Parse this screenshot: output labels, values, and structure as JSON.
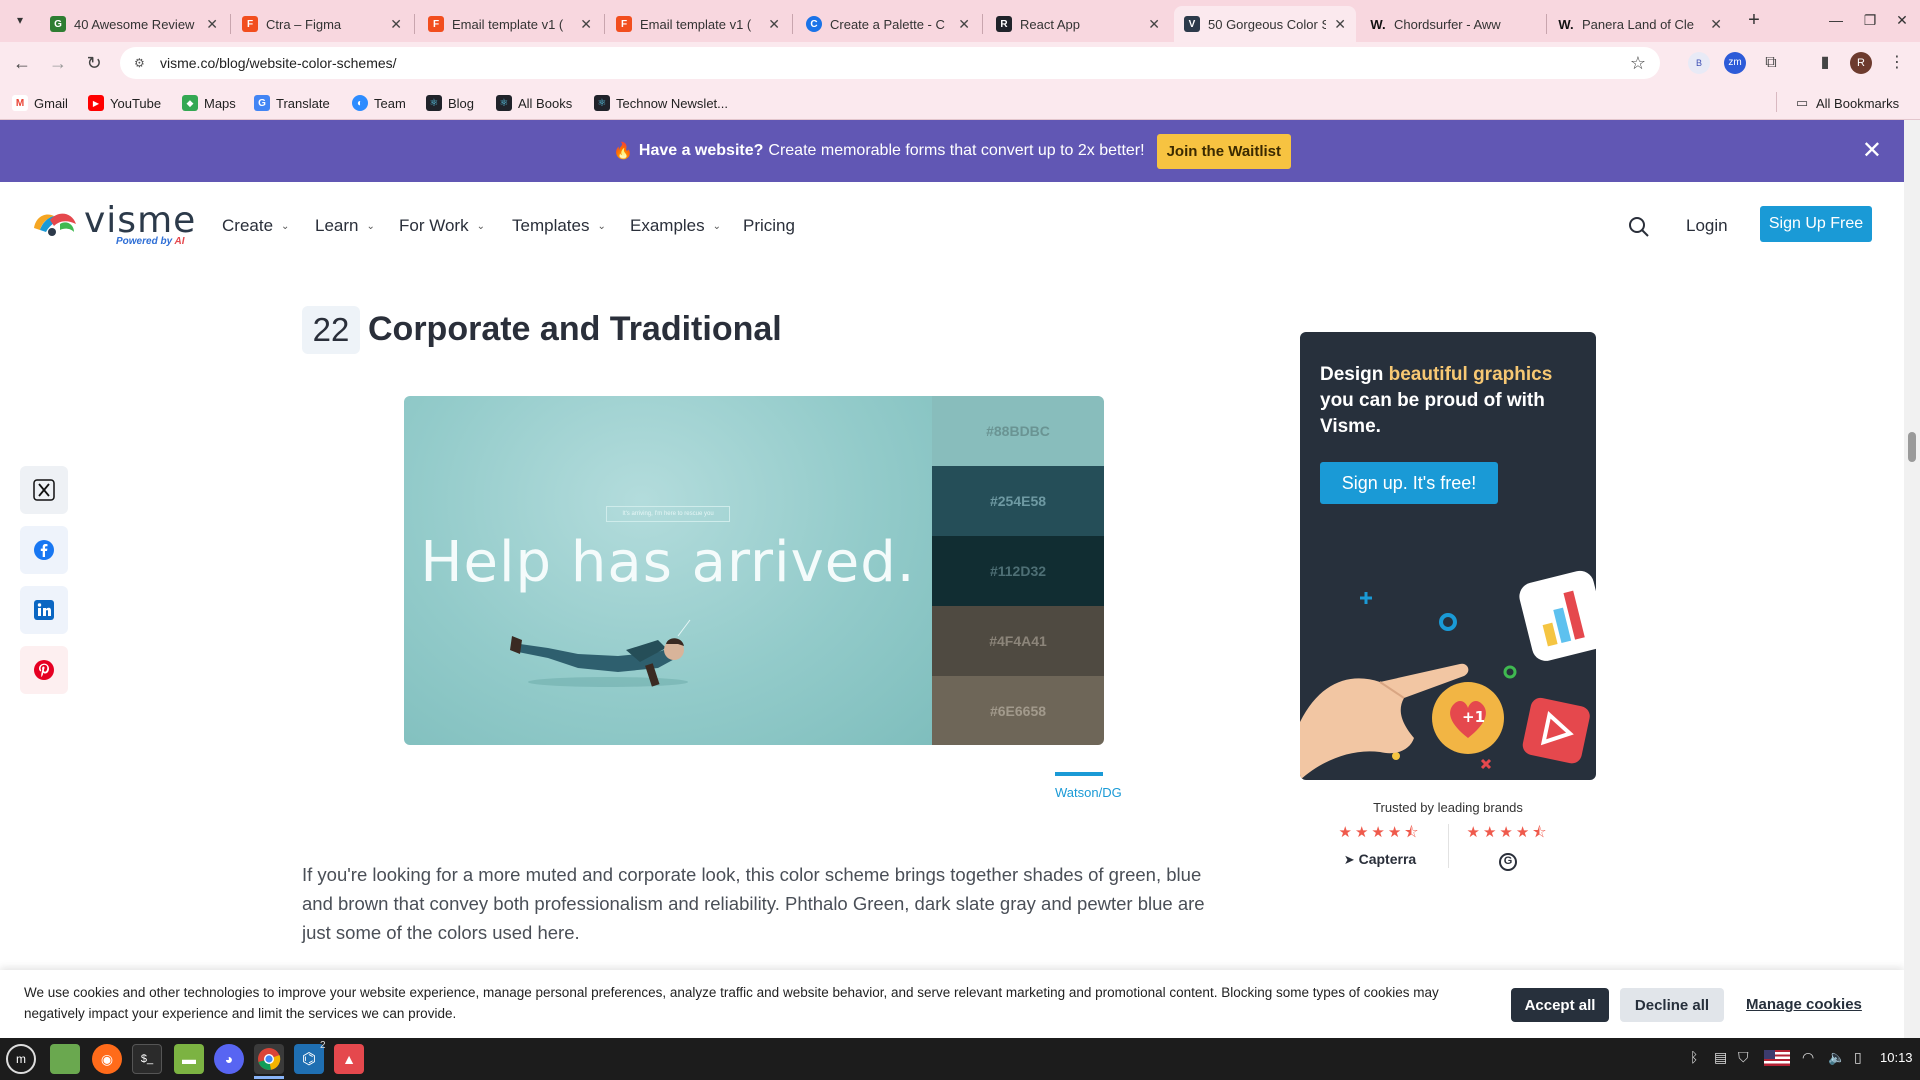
{
  "browser": {
    "tabs": [
      {
        "label": "40 Awesome Review",
        "color": "#2e7d32",
        "icon": "G"
      },
      {
        "label": "Ctra – Figma",
        "color": "#f24e1e",
        "icon": "F"
      },
      {
        "label": "Email template v1 (",
        "color": "#f24e1e",
        "icon": "F"
      },
      {
        "label": "Email template v1 (",
        "color": "#f24e1e",
        "icon": "F"
      },
      {
        "label": "Create a Palette - C",
        "color": "#1a73e8",
        "icon": "C"
      },
      {
        "label": "React App",
        "color": "#20232a",
        "icon": "R"
      },
      {
        "label": "50 Gorgeous Color S",
        "color": "#2c3a4a",
        "icon": "V"
      },
      {
        "label": "Chordsurfer - Aww",
        "color": "#111111",
        "icon": "W."
      },
      {
        "label": "Panera Land of Cle",
        "color": "#111111",
        "icon": "W."
      }
    ],
    "url": "visme.co/blog/website-color-schemes/",
    "bookmarks": [
      {
        "label": "Gmail",
        "color": "#ea4335",
        "icon": "M"
      },
      {
        "label": "YouTube",
        "color": "#ff0000",
        "icon": "▶"
      },
      {
        "label": "Maps",
        "color": "#34a853",
        "icon": "◆"
      },
      {
        "label": "Translate",
        "color": "#4285f4",
        "icon": "G"
      },
      {
        "label": "Team",
        "color": "#2d8cff",
        "icon": "◐"
      },
      {
        "label": "Blog",
        "color": "#20232a",
        "icon": "⚛"
      },
      {
        "label": "All Books",
        "color": "#20232a",
        "icon": "⚛"
      },
      {
        "label": "Technow Newslet...",
        "color": "#20232a",
        "icon": "⚛"
      }
    ],
    "all_bookmarks": "All Bookmarks",
    "profile_initial": "R"
  },
  "promo": {
    "bold": "Have a website?",
    "text": "Create memorable forms that convert up to 2x better!",
    "cta": "Join the Waitlist"
  },
  "nav": {
    "logo_word": "visme",
    "powered_prefix": "Powered by ",
    "powered_ai": "AI",
    "items": [
      "Create",
      "Learn",
      "For Work",
      "Templates",
      "Examples",
      "Pricing"
    ],
    "login": "Login",
    "signup": "Sign Up Free"
  },
  "article": {
    "number": "22",
    "heading": "Corporate and Traditional",
    "image_headline": "Help has arrived.",
    "image_tagline": "It's arriving, I'm here to rescue you",
    "swatches": [
      {
        "hex": "#88BDBC",
        "label_color": "#6a9493"
      },
      {
        "hex": "#254E58",
        "label_color": "#6f9aa3"
      },
      {
        "hex": "#112D32",
        "label_color": "#4e6f75"
      },
      {
        "hex": "#4F4A41",
        "label_color": "#8c857a"
      },
      {
        "hex": "#6E6658",
        "label_color": "#a29a8c"
      }
    ],
    "credit": "Watson/DG",
    "paragraph": "If you're looking for a more muted and corporate look, this color scheme brings together shades of green, blue and brown that convey both professionalism and reliability. Phthalo Green, dark slate gray and pewter blue are just some of the colors used here."
  },
  "sidebar_ad": {
    "line1": "Design ",
    "highlight": "beautiful graphics",
    "line2": " you can be proud of with Visme.",
    "cta": "Sign up. It's free!",
    "trusted": "Trusted by leading brands",
    "ratings": [
      {
        "brand": "Capterra",
        "rating": 4.5
      },
      {
        "brand": "G",
        "rating": 4.5
      }
    ]
  },
  "share": [
    {
      "icon": "x-icon",
      "bg": "#eef1f5"
    },
    {
      "icon": "facebook-icon",
      "bg": "#eef3fb"
    },
    {
      "icon": "linkedin-icon",
      "bg": "#eef3fb"
    },
    {
      "icon": "pinterest-icon",
      "bg": "#fdeff0"
    }
  ],
  "cookie": {
    "text": "We use cookies and other technologies to improve your website experience, manage personal preferences, analyze traffic and website behavior, and serve relevant marketing and promotional content. Blocking some types of cookies may negatively impact your experience and limit the services we can provide.",
    "accept": "Accept all",
    "decline": "Decline all",
    "manage": "Manage cookies"
  },
  "taskbar": {
    "clock": "10:13",
    "vscode_badge": "2"
  }
}
